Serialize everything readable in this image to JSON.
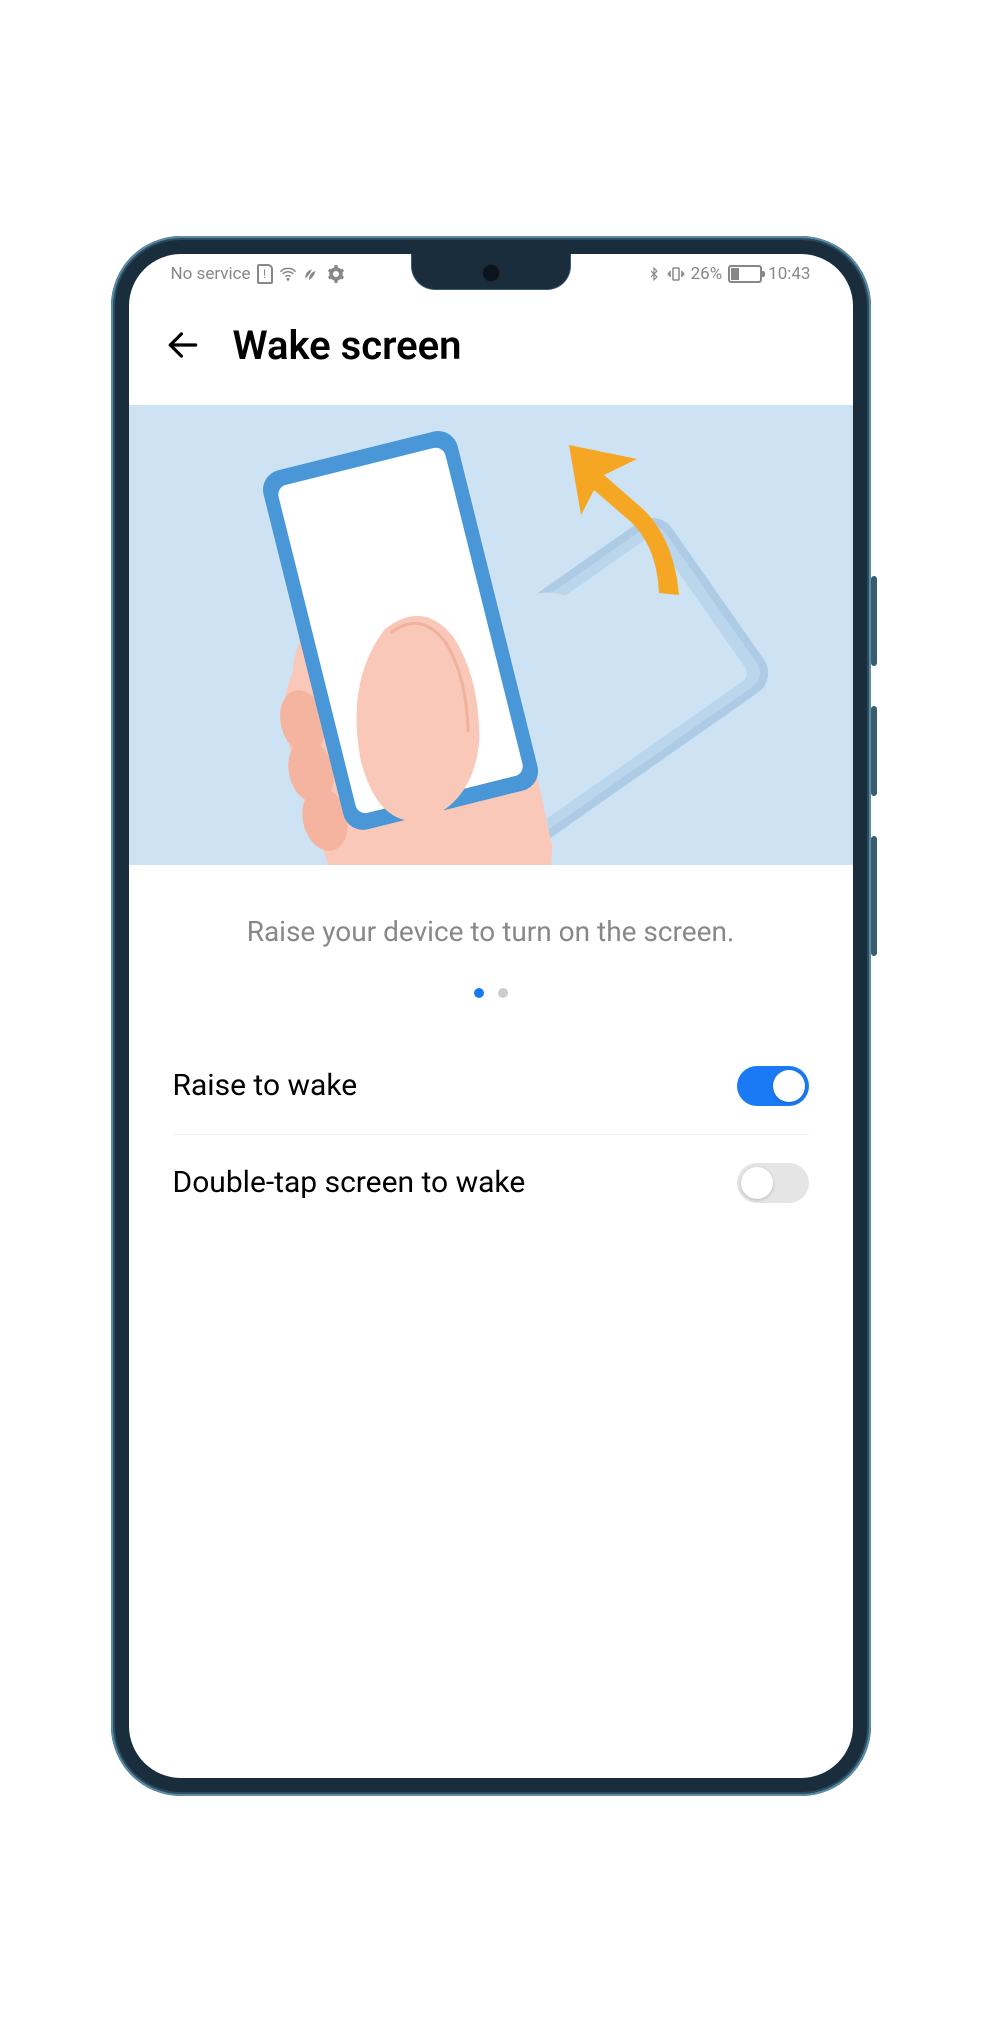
{
  "status_bar": {
    "no_service": "No service",
    "battery_percent": "26%",
    "time": "10:43"
  },
  "header": {
    "title": "Wake screen"
  },
  "illustration": {
    "caption": "Raise your device to turn on the screen.",
    "pager": {
      "total": 2,
      "active": 0
    }
  },
  "settings": [
    {
      "label": "Raise to wake",
      "enabled": true
    },
    {
      "label": "Double-tap screen to wake",
      "enabled": false
    }
  ]
}
